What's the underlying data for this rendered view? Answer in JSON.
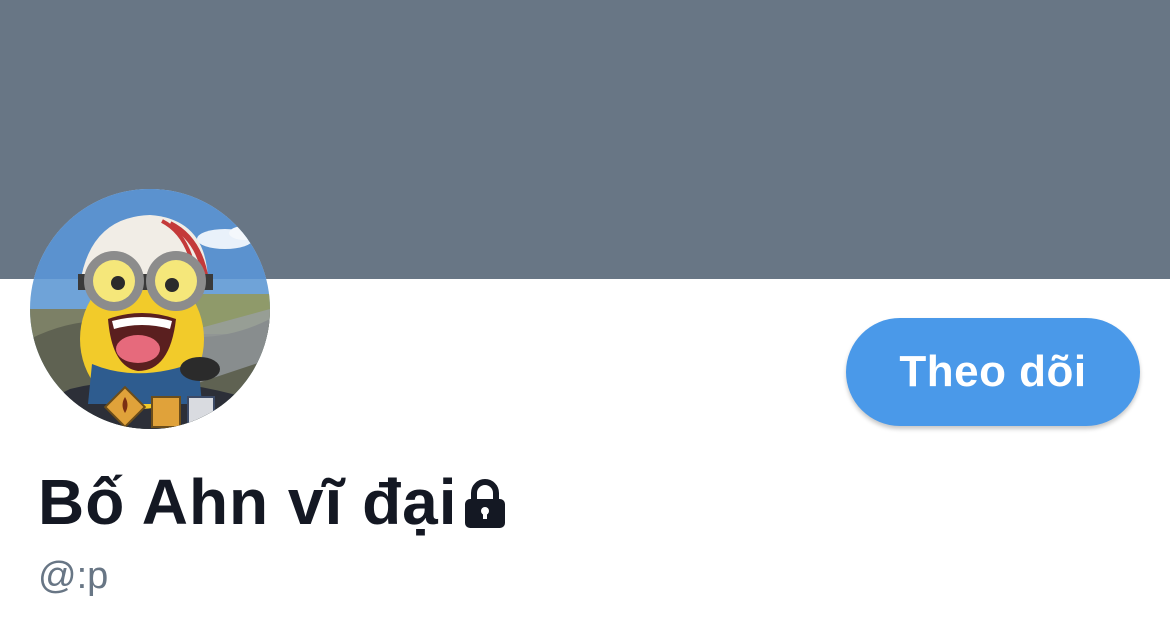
{
  "header": {
    "banner_color": "#687685"
  },
  "profile": {
    "avatar_icon": "minion-avatar-photo",
    "display_name": "Bố Ahn vĩ đại",
    "protected_icon": "lock-icon",
    "handle": "@:p"
  },
  "actions": {
    "follow_label": "Theo dõi",
    "follow_color": "#4a99e9"
  }
}
